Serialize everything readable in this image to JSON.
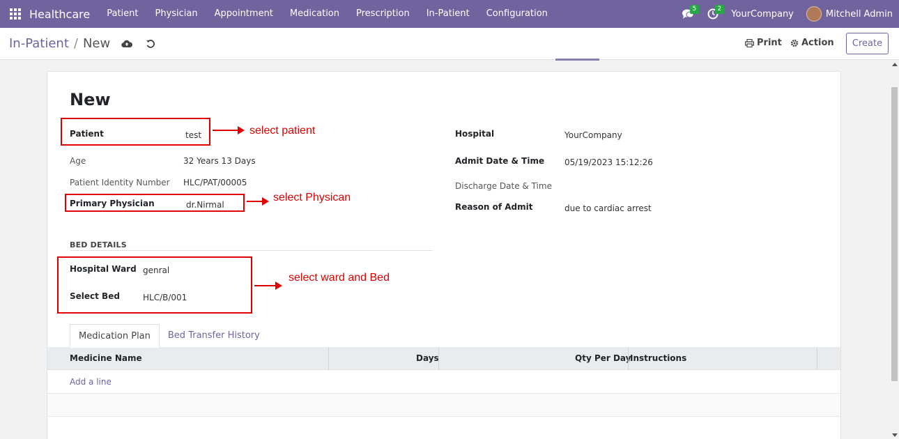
{
  "navbar": {
    "brand": "Healthcare",
    "menu": [
      "Patient",
      "Physician",
      "Appointment",
      "Medication",
      "Prescription",
      "In-Patient",
      "Configuration"
    ],
    "messages_count": "5",
    "activities_count": "2",
    "company": "YourCompany",
    "user": "Mitchell Admin",
    "color": "#71639e"
  },
  "control": {
    "breadcrumb_parent": "In-Patient",
    "breadcrumb_sep": "/",
    "breadcrumb_current": "New",
    "print_label": "Print",
    "action_label": "Action",
    "create_label": "Create"
  },
  "form": {
    "title": "New",
    "left": {
      "patient_label": "Patient",
      "patient_value": "test",
      "age_label": "Age",
      "age_value": "32 Years 13 Days",
      "pid_label": "Patient Identity Number",
      "pid_value": "HLC/PAT/00005",
      "physician_label": "Primary Physician",
      "physician_value": "dr.Nirmal"
    },
    "right": {
      "hospital_label": "Hospital",
      "hospital_value": "YourCompany",
      "admit_label": "Admit Date & Time",
      "admit_value": "05/19/2023 15:12:26",
      "discharge_label": "Discharge Date & Time",
      "reason_label": "Reason of Admit",
      "reason_value": "due to cardiac arrest"
    },
    "bed": {
      "section_title": "BED DETAILS",
      "ward_label": "Hospital Ward",
      "ward_value": "genral",
      "bed_label": "Select Bed",
      "bed_value": "HLC/B/001"
    }
  },
  "annotations": {
    "patient": "select patient",
    "physician": "select Physican",
    "ward_bed": "select ward and Bed",
    "color": "#e00000"
  },
  "tabs": [
    "Medication Plan",
    "Bed Transfer History"
  ],
  "table": {
    "columns": [
      "Medicine Name",
      "Days",
      "Qty Per Day",
      "Instructions"
    ],
    "add_line": "Add a line"
  }
}
